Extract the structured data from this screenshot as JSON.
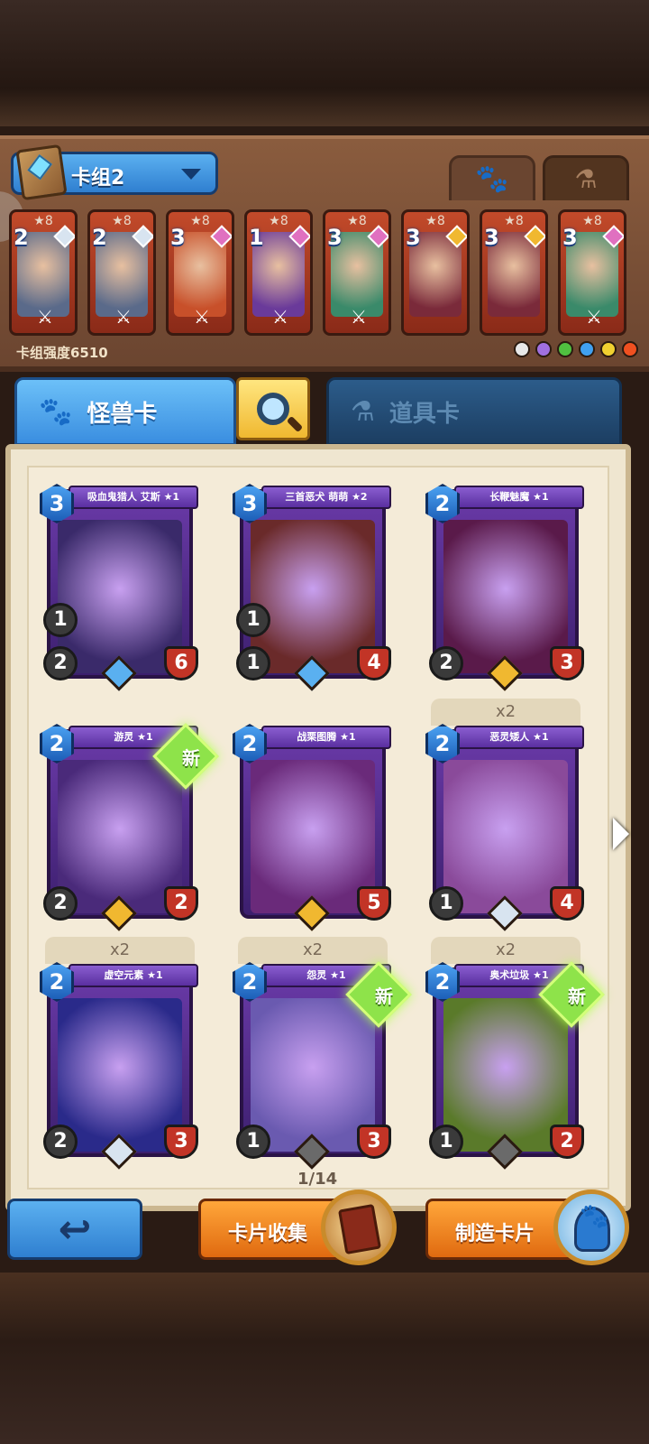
{
  "deck": {
    "name": "卡组2",
    "power_label": "卡组强度6510",
    "cards": [
      {
        "stars": "★8",
        "cost": "2",
        "gem_color": "#d8e4f0",
        "art_color": "#5a6a8a"
      },
      {
        "stars": "★8",
        "cost": "2",
        "gem_color": "#d8e4f0",
        "art_color": "#5a6a8a"
      },
      {
        "stars": "★8",
        "cost": "3",
        "gem_color": "#e070c0",
        "art_color": "#c8502a"
      },
      {
        "stars": "★8",
        "cost": "1",
        "gem_color": "#e070c0",
        "art_color": "#6a3a9a"
      },
      {
        "stars": "★8",
        "cost": "3",
        "gem_color": "#e070c0",
        "art_color": "#3a8a6a"
      },
      {
        "stars": "★8",
        "cost": "3",
        "gem_color": "#f0b830",
        "art_color": "#7a2a3a"
      },
      {
        "stars": "★8",
        "cost": "3",
        "gem_color": "#f0b830",
        "art_color": "#7a2a3a"
      },
      {
        "stars": "★8",
        "cost": "3",
        "gem_color": "#e070c0",
        "art_color": "#3a8a6a"
      }
    ],
    "element_colors": [
      "#e8e8e8",
      "#a070e0",
      "#50c040",
      "#40a0f0",
      "#f0d030",
      "#f05020"
    ]
  },
  "tabs": {
    "monster": "怪兽卡",
    "items": "道具卡"
  },
  "cards": [
    {
      "title": "吸血鬼猎人 艾斯 ★1",
      "cost": "3",
      "stat_a": "1",
      "stat_b": "2",
      "stat_c": "6",
      "rarity": "#5ab0f0",
      "art": "#3a2a6a",
      "new": false,
      "dup": ""
    },
    {
      "title": "三首恶犬 萌萌 ★2",
      "cost": "3",
      "stat_a": "1",
      "stat_b": "1",
      "stat_c": "4",
      "rarity": "#5ab0f0",
      "art": "#6a2a2a",
      "new": false,
      "dup": ""
    },
    {
      "title": "长鞭魅魔 ★1",
      "cost": "2",
      "stat_a": "",
      "stat_b": "2",
      "stat_c": "3",
      "rarity": "#f0b830",
      "art": "#5a1a4a",
      "new": false,
      "dup": ""
    },
    {
      "title": "游灵 ★1",
      "cost": "2",
      "stat_a": "",
      "stat_b": "2",
      "stat_c": "2",
      "rarity": "#f0b830",
      "art": "#4a2a7a",
      "new": true,
      "dup": ""
    },
    {
      "title": "战栗图腾 ★1",
      "cost": "2",
      "stat_a": "",
      "stat_b": "",
      "stat_c": "5",
      "rarity": "#f0b830",
      "art": "#6a2a7a",
      "new": false,
      "dup": ""
    },
    {
      "title": "恶灵矮人 ★1",
      "cost": "2",
      "stat_a": "",
      "stat_b": "1",
      "stat_c": "4",
      "rarity": "#d8e4f0",
      "art": "#8a4a9a",
      "new": false,
      "dup": "x2"
    },
    {
      "title": "虚空元素 ★1",
      "cost": "2",
      "stat_a": "",
      "stat_b": "2",
      "stat_c": "3",
      "rarity": "#d8e4f0",
      "art": "#2a2a8a",
      "new": false,
      "dup": "x2"
    },
    {
      "title": "怨灵 ★1",
      "cost": "2",
      "stat_a": "",
      "stat_b": "1",
      "stat_c": "3",
      "rarity": "#6a6a6a",
      "art": "#6a5ab0",
      "new": true,
      "dup": "x2"
    },
    {
      "title": "奥术垃圾 ★1",
      "cost": "2",
      "stat_a": "",
      "stat_b": "1",
      "stat_c": "2",
      "rarity": "#6a6a6a",
      "art": "#5a7a2a",
      "new": true,
      "dup": "x2"
    }
  ],
  "new_label": "新",
  "page": "1/14",
  "buttons": {
    "collect": "卡片收集",
    "craft": "制造卡片"
  }
}
